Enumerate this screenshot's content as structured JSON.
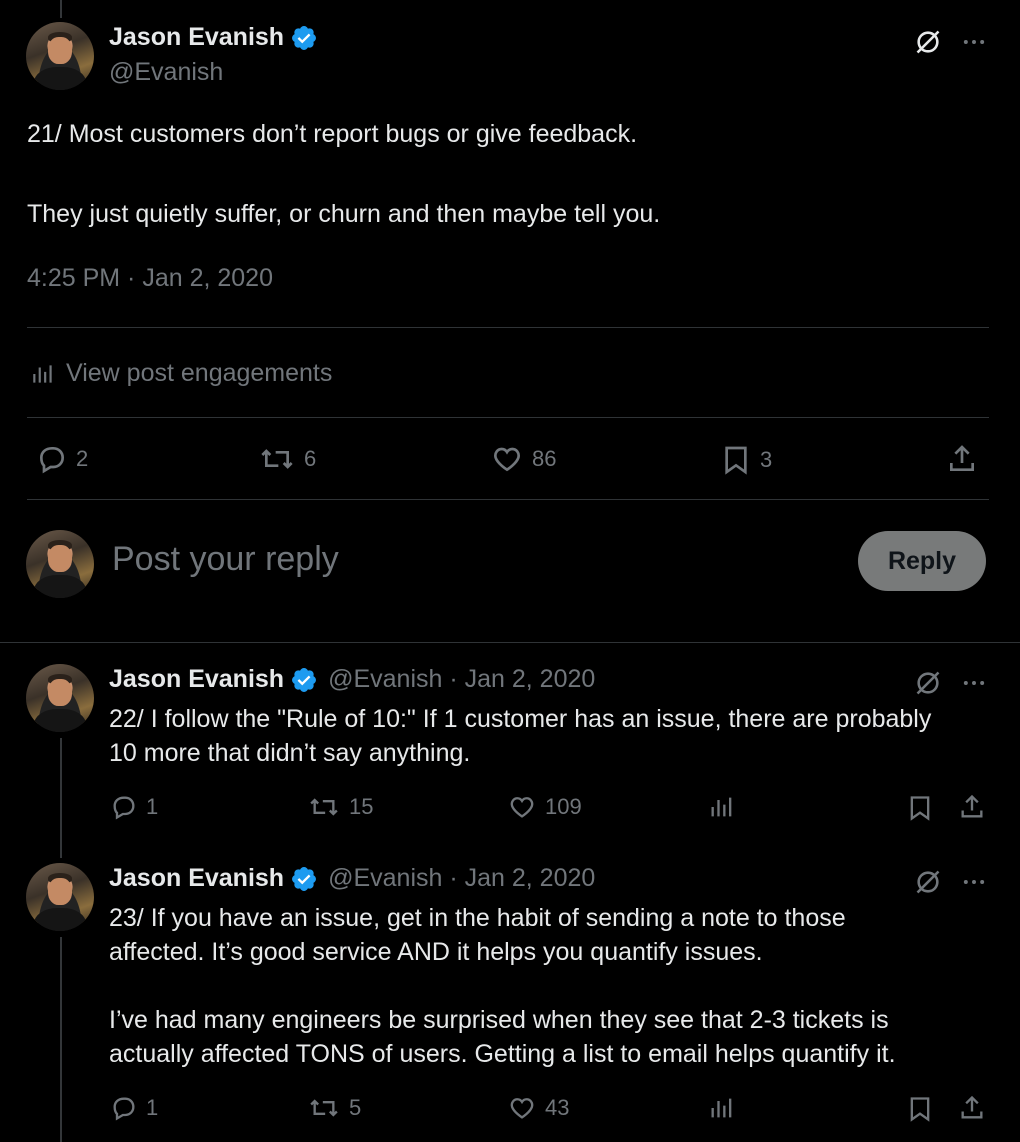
{
  "main_post": {
    "author_name": "Jason Evanish",
    "author_handle": "@Evanish",
    "text_line1": "21/ Most customers don’t report bugs or give feedback.",
    "text_line2": "They just quietly suffer, or churn and then maybe tell you.",
    "timestamp": "4:25 PM · Jan 2, 2020",
    "engagements_label": "View post engagements",
    "counts": {
      "replies": "2",
      "reposts": "6",
      "likes": "86",
      "bookmarks": "3"
    }
  },
  "composer": {
    "placeholder": "Post your reply",
    "reply_label": "Reply"
  },
  "replies": [
    {
      "author_name": "Jason Evanish",
      "handle_date": "@Evanish · Jan 2, 2020",
      "line1": "22/ I follow the \"Rule of 10:\" If 1 customer has an issue, there are probably",
      "line2": "10 more that didn’t say anything.",
      "counts": {
        "replies": "1",
        "reposts": "15",
        "likes": "109"
      }
    },
    {
      "author_name": "Jason Evanish",
      "handle_date": "@Evanish · Jan 2, 2020",
      "line1": "23/ If you have an issue, get in the habit of sending a note to those",
      "line2": "affected. It’s good service AND it helps you quantify issues.",
      "line3": "I’ve had many engineers be surprised when they see that 2-3 tickets is",
      "line4": "actually affected TONS of users. Getting a list to email helps quantify it.",
      "counts": {
        "replies": "1",
        "reposts": "5",
        "likes": "43"
      }
    }
  ],
  "colors": {
    "verified": "#1d9bf0",
    "muted": "#71767b",
    "text": "#e7e9ea"
  }
}
